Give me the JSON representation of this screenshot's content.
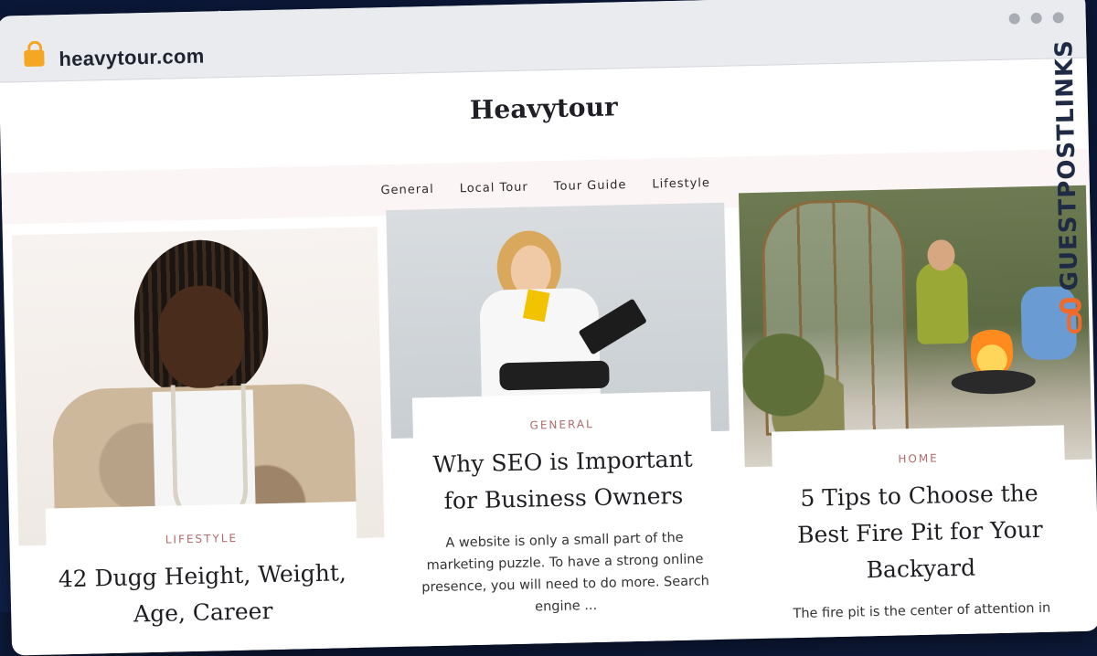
{
  "browser": {
    "url": "heavytour.com",
    "lock_icon": "lock-icon",
    "window_controls": [
      "dot",
      "dot",
      "dot"
    ]
  },
  "site": {
    "title": "Heavytour",
    "nav": [
      "General",
      "Local Tour",
      "Tour Guide",
      "Lifestyle"
    ]
  },
  "posts": [
    {
      "category": "LIFESTYLE",
      "title": "42 Dugg Height, Weight, Age, Career",
      "excerpt": ""
    },
    {
      "category": "GENERAL",
      "title": "Why SEO is Important for Business Owners",
      "excerpt": "A website is only a small part of the marketing puzzle. To have a strong online presence, you will need to do more. Search engine ..."
    },
    {
      "category": "HOME",
      "title": "5 Tips to Choose the Best Fire Pit for Your Backyard",
      "excerpt": "The fire pit is the center of attention in"
    }
  ],
  "brand": {
    "text": "GUESTPOSTLINKS",
    "accent": "#f06a2b"
  }
}
